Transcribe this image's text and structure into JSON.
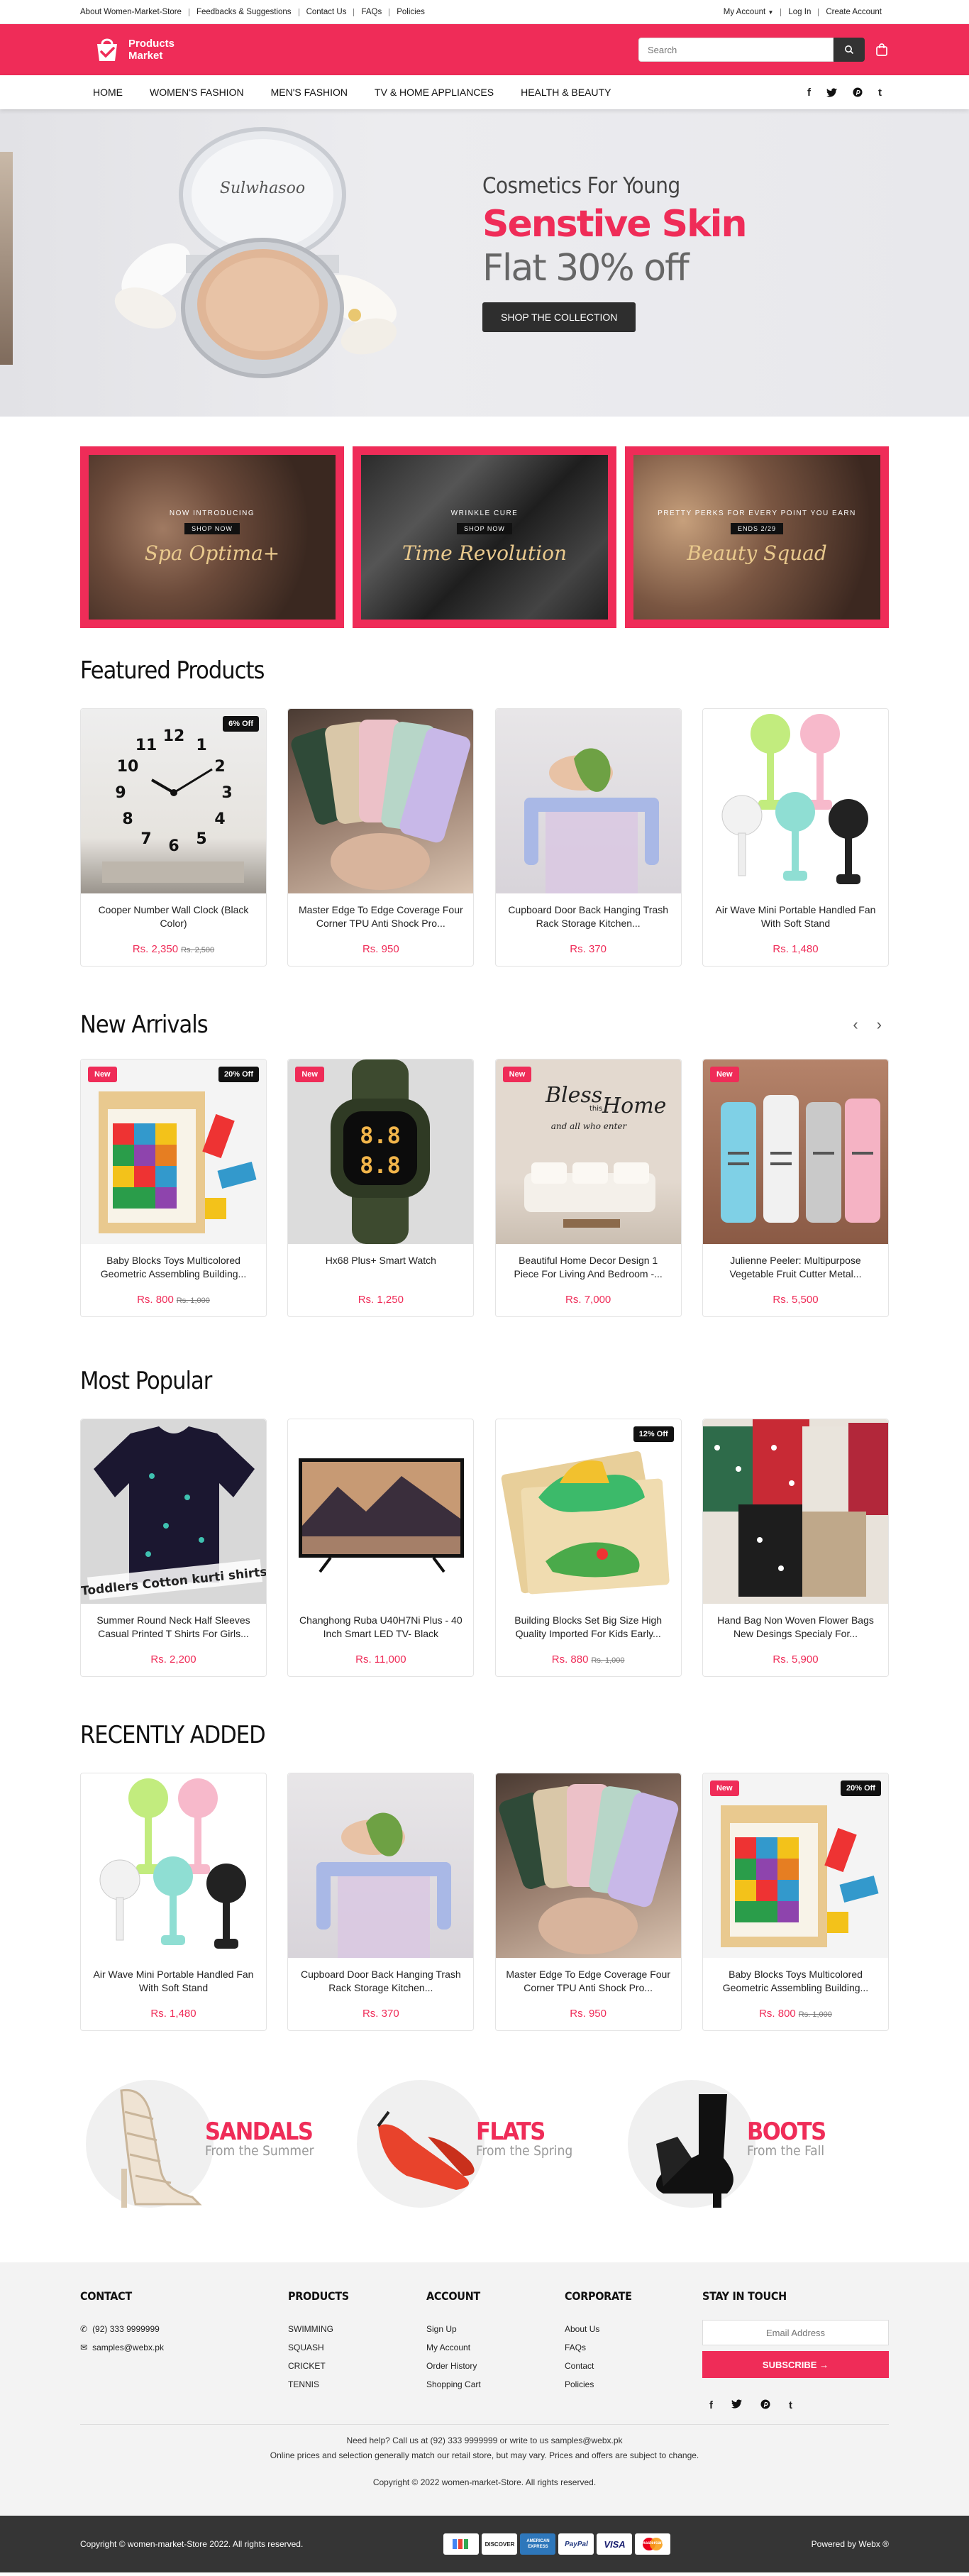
{
  "topbar": {
    "links": [
      "About Women-Market-Store",
      "Feedbacks & Suggestions",
      "Contact Us",
      "FAQs",
      "Policies"
    ],
    "account": "My Account",
    "login": "Log In",
    "create": "Create Account"
  },
  "header": {
    "logo_line1": "Products",
    "logo_line2": "Market",
    "search_placeholder": "Search"
  },
  "nav": {
    "items": [
      "HOME",
      "WOMEN'S FASHION",
      "MEN'S FASHION",
      "TV & HOME APPLIANCES",
      "HEALTH & BEAUTY"
    ]
  },
  "hero": {
    "line1": "Cosmetics For Young",
    "line2": "Senstive Skin",
    "line3": "Flat 30% off",
    "button": "SHOP THE COLLECTION",
    "brand": "Sulwhasoo"
  },
  "promos": [
    {
      "kicker": "NOW INTRODUCING",
      "btn": "SHOP NOW",
      "title": "Spa Optima+"
    },
    {
      "kicker": "WRINKLE CURE",
      "btn": "SHOP NOW",
      "title": "Time Revolution"
    },
    {
      "kicker": "PRETTY PERKS FOR EVERY POINT YOU EARN",
      "btn": "ENDS 2/29",
      "title": "Beauty Squad"
    }
  ],
  "featured": {
    "title": "Featured Products",
    "products": [
      {
        "name": "Cooper Number Wall Clock (Black Color)",
        "price": "Rs. 2,350",
        "old": "Rs. 2,500",
        "off": "6% Off",
        "new": ""
      },
      {
        "name": "Master Edge To Edge Coverage Four Corner TPU Anti Shock Pro...",
        "price": "Rs. 950",
        "old": "",
        "off": "",
        "new": ""
      },
      {
        "name": "Cupboard Door Back Hanging Trash Rack Storage Kitchen...",
        "price": "Rs. 370",
        "old": "",
        "off": "",
        "new": ""
      },
      {
        "name": "Air Wave Mini Portable Handled Fan With Soft Stand",
        "price": "Rs. 1,480",
        "old": "",
        "off": "",
        "new": ""
      }
    ]
  },
  "new_arrivals": {
    "title": "New Arrivals",
    "products": [
      {
        "name": "Baby Blocks Toys Multicolored Geometric Assembling Building...",
        "price": "Rs. 800",
        "old": "Rs. 1,000",
        "off": "20% Off",
        "new": "New"
      },
      {
        "name": "Hx68 Plus+ Smart Watch",
        "price": "Rs. 1,250",
        "old": "",
        "off": "",
        "new": "New"
      },
      {
        "name": "Beautiful Home Decor Design 1 Piece For Living And Bedroom -...",
        "price": "Rs. 7,000",
        "old": "",
        "off": "",
        "new": "New"
      },
      {
        "name": "Julienne Peeler: Multipurpose Vegetable Fruit Cutter Metal...",
        "price": "Rs. 5,500",
        "old": "",
        "off": "",
        "new": "New"
      }
    ]
  },
  "most_popular": {
    "title": "Most Popular",
    "products": [
      {
        "name": "Summer Round Neck Half Sleeves Casual Printed T Shirts For Girls...",
        "price": "Rs. 2,200",
        "old": "",
        "off": "",
        "new": ""
      },
      {
        "name": "Changhong Ruba U40H7Ni Plus - 40 Inch Smart LED TV- Black",
        "price": "Rs. 11,000",
        "old": "",
        "off": "",
        "new": ""
      },
      {
        "name": "Building Blocks Set Big Size High Quality Imported For Kids Early...",
        "price": "Rs. 880",
        "old": "Rs. 1,000",
        "off": "12% Off",
        "new": ""
      },
      {
        "name": "Hand Bag Non Woven Flower Bags New Desings Specialy For...",
        "price": "Rs. 5,900",
        "old": "",
        "off": "",
        "new": ""
      }
    ]
  },
  "recently_added": {
    "title": "RECENTLY ADDED",
    "products": [
      {
        "name": "Air Wave Mini Portable Handled Fan With Soft Stand",
        "price": "Rs. 1,480",
        "old": "",
        "off": "",
        "new": ""
      },
      {
        "name": "Cupboard Door Back Hanging Trash Rack Storage Kitchen...",
        "price": "Rs. 370",
        "old": "",
        "off": "",
        "new": ""
      },
      {
        "name": "Master Edge To Edge Coverage Four Corner TPU Anti Shock Pro...",
        "price": "Rs. 950",
        "old": "",
        "off": "",
        "new": ""
      },
      {
        "name": "Baby Blocks Toys Multicolored Geometric Assembling Building...",
        "price": "Rs. 800",
        "old": "Rs. 1,000",
        "off": "20% Off",
        "new": "New"
      }
    ]
  },
  "image_text": {
    "toddler": "Toddlers Cotton kurti shirts",
    "decor1": "Bless",
    "decor2": "this",
    "decor3": "Home",
    "decor4": "and all who enter"
  },
  "categories": [
    {
      "title": "SANDALS",
      "sub": "From the Summer"
    },
    {
      "title": "FLATS",
      "sub": "From the Spring"
    },
    {
      "title": "BOOTS",
      "sub": "From the Fall"
    }
  ],
  "footer": {
    "contact_title": "CONTACT",
    "phone": "(92) 333 9999999",
    "email": "samples@webx.pk",
    "products_title": "PRODUCTS",
    "products": [
      "SWIMMING",
      "SQUASH",
      "CRICKET",
      "TENNIS"
    ],
    "account_title": "ACCOUNT",
    "account": [
      "Sign Up",
      "My Account",
      "Order History",
      "Shopping Cart"
    ],
    "corporate_title": "CORPORATE",
    "corporate": [
      "About Us",
      "FAQs",
      "Contact",
      "Policies"
    ],
    "stay_title": "STAY IN TOUCH",
    "email_placeholder": "Email Address",
    "subscribe": "SUBSCRIBE →",
    "help1": "Need help? Call us at (92) 333 9999999 or write to us samples@webx.pk",
    "help2": "Online prices and selection generally match our retail store, but may vary. Prices and offers are subject to change.",
    "copyright": "Copyright © 2022 women-market-Store. All rights reserved."
  },
  "bottombar": {
    "left": "Copyright © women-market-Store 2022. All rights reserved.",
    "right": "Powered by Webx ®",
    "payments": [
      "",
      "DISCOVER",
      "AMERICAN EXPRESS",
      "PayPal",
      "VISA",
      "mastercard"
    ]
  },
  "colors": {
    "accent": "#ef2c58",
    "dark": "#333333"
  }
}
